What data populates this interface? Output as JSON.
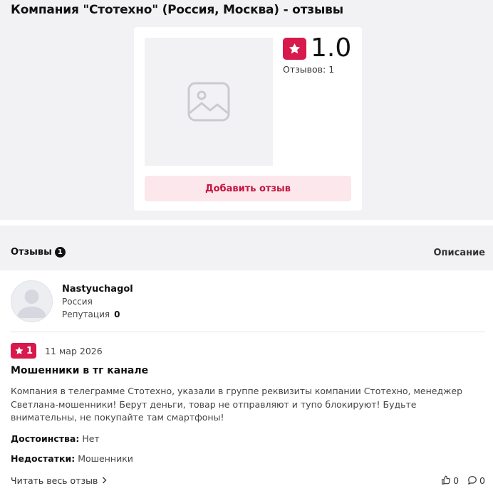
{
  "page": {
    "title": "Компания \"Стотехно\" (Россия, Москва) - отзывы"
  },
  "summary": {
    "rating": "1.0",
    "reviews_label": "Отзывов: 1",
    "add_review_label": "Добавить отзыв",
    "accent_color": "#d7194c"
  },
  "tabs": {
    "reviews_label": "Отзывы",
    "reviews_count": "1",
    "description_label": "Описание"
  },
  "review": {
    "author": {
      "name": "Nastyuchagol",
      "country": "Россия",
      "reputation_label": "Репутация",
      "reputation_value": "0"
    },
    "rating": "1",
    "date": "11 мар 2026",
    "title": "Мошенники в тг канале",
    "text": "Компания в телеграмме Стотехно, указали в группе реквизиты компании Стотехно, менеджер Светлана-мошенники! Берут деньги, товар не отправляют и тупо блокируют! Будьте внимательны, не покупайте там смартфоны!",
    "pros_label": "Достоинства:",
    "pros_value": "Нет",
    "cons_label": "Недостатки:",
    "cons_value": "Мошенники",
    "read_more_label": "Читать весь отзыв",
    "likes": "0",
    "comments": "0"
  }
}
